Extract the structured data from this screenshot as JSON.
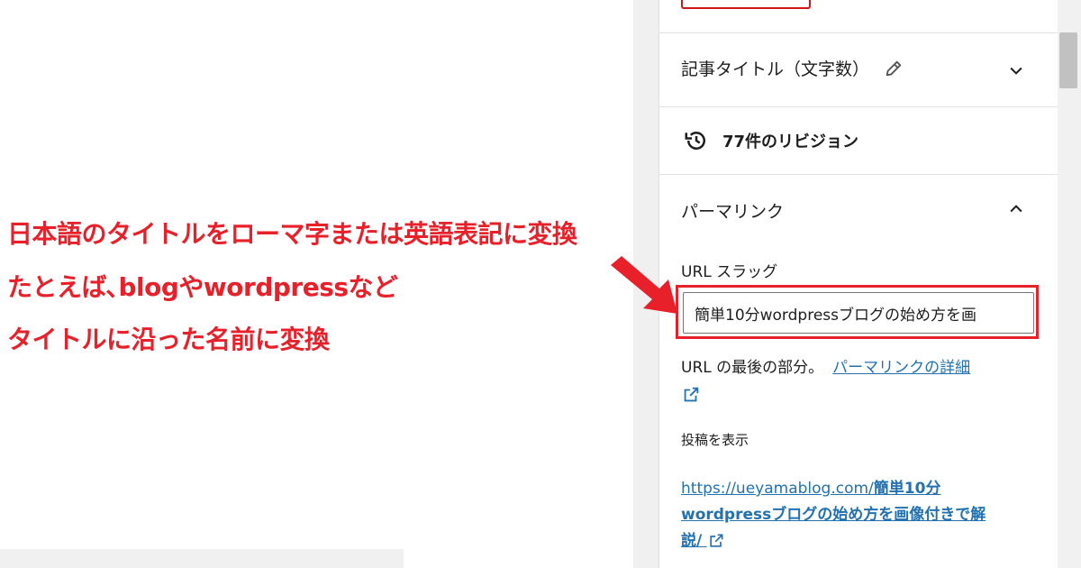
{
  "panels": {
    "title_panel": {
      "label": "記事タイトル（文字数）"
    },
    "revisions": {
      "label": "77件のリビジョン"
    },
    "permalink": {
      "label": "パーマリンク",
      "slug_label": "URL スラッグ",
      "slug_value": "簡単10分wordpressブログの始め方を画",
      "help_prefix": "URL の最後の部分。",
      "help_link": "パーマリンクの詳細",
      "view_label": "投稿を表示",
      "post_url_base": "https://ueyamablog.com/",
      "post_url_slug_1": "簡単10分",
      "post_url_slug_2": "wordpressブログの始め方を画像付きで解",
      "post_url_slug_3": "説/"
    }
  },
  "annotation": {
    "line1": "日本語のタイトルをローマ字または英語表記に変換",
    "line2": "たとえば､blogやwordpressなど",
    "line3": "タイトルに沿った名前に変換"
  },
  "colors": {
    "annotation": "#e8202a",
    "link": "#2271b1"
  },
  "icons": [
    "pencil-icon",
    "chevron-down-icon",
    "history-icon",
    "chevron-up-icon",
    "external-link-icon",
    "arrow-icon"
  ]
}
